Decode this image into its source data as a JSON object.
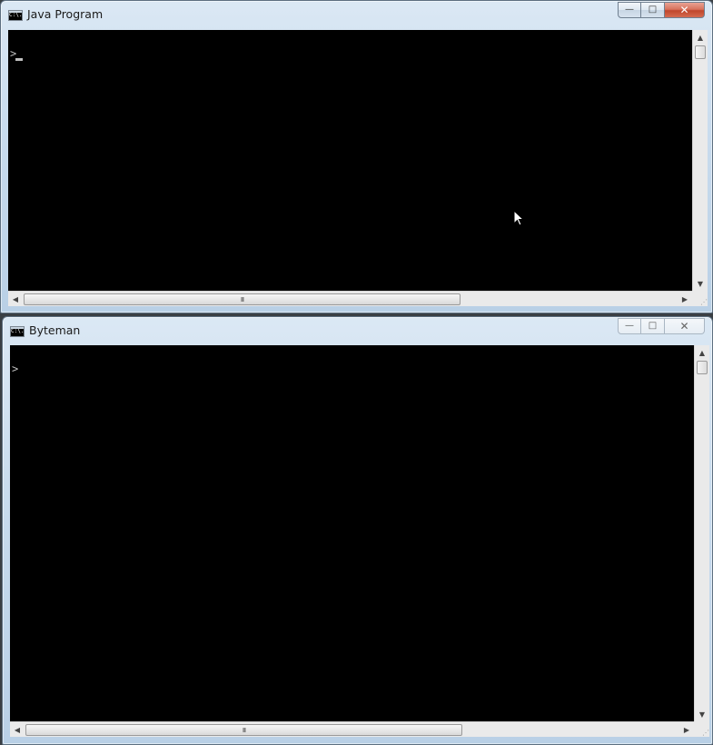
{
  "windows": [
    {
      "title": "Java Program",
      "icon": "console-icon",
      "icon_text": "C:\\.",
      "controls": {
        "minimize": "—",
        "maximize": "□",
        "close": "✕"
      },
      "prompt": ">",
      "state": "active",
      "hscroll_thumb": "III"
    },
    {
      "title": "Byteman",
      "icon": "console-icon",
      "icon_text": "C:\\.",
      "controls": {
        "minimize": "—",
        "maximize": "□",
        "close": "✕"
      },
      "prompt": ">",
      "state": "inactive",
      "hscroll_thumb": "III"
    }
  ],
  "scroll_arrows": {
    "up": "▲",
    "down": "▼",
    "left": "◀",
    "right": "▶"
  },
  "colors": {
    "console_bg": "#000000",
    "console_text": "#c0c0c0",
    "close_button": "#c7472c"
  }
}
